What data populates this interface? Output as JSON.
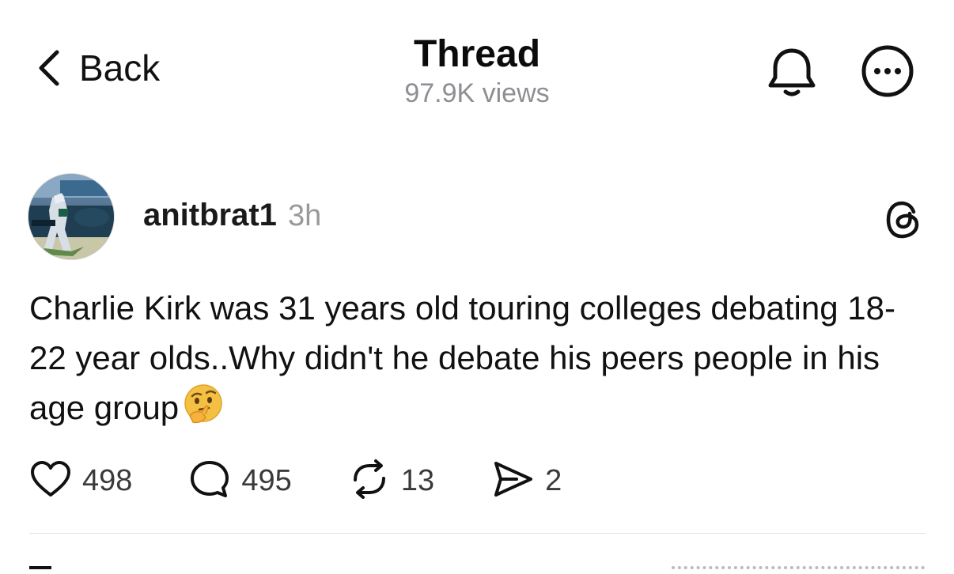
{
  "header": {
    "back_label": "Back",
    "title": "Thread",
    "views": "97.9K views",
    "icons": [
      "chevron-left-icon",
      "bell-icon",
      "more-icon"
    ]
  },
  "post": {
    "username": "anitbrat1",
    "timestamp": "3h",
    "text": "Charlie Kirk was 31 years old touring colleges debating 18-22 year olds..Why didn't he debate his peers people in his age group",
    "emoji": "🤔",
    "logo_icon": "threads-logo-icon",
    "actions": {
      "likes": "498",
      "replies": "495",
      "reposts": "13",
      "shares": "2"
    }
  },
  "colors": {
    "text": "#111111",
    "muted": "#8e8e93",
    "divider": "#e0e0e0"
  }
}
